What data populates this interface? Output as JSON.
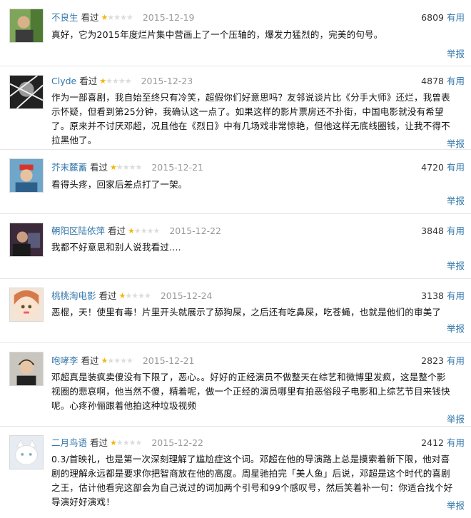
{
  "reviews": [
    {
      "user": "不良生",
      "seen": "看过",
      "rating": 1,
      "date": "2015-12-19",
      "votes": "6809",
      "useful_label": "有用",
      "text": "真好，它为2015年度烂片集中营画上了一个压轴的，爆发力猛烈的，完美的句号。",
      "report_label": "举报",
      "avatar_icon": "green-portrait-avatar"
    },
    {
      "user": "Clyde",
      "seen": "看过",
      "rating": 1,
      "date": "2015-12-23",
      "votes": "4878",
      "useful_label": "有用",
      "text": "作为一部喜剧，我自始至终只有冷笑，超假你们好意思吗？友邻说谈片比《分手大师》还烂，我曾表示怀疑，但看到第25分钟，我确认这一点了。如果这样的影片票房还不扑街，中国电影就没有希望了。原来并不讨厌邓超，况且他在《烈日》中有几场戏非常惊艳，但他这样无底线圈钱，让我不得不拉黑他了。",
      "report_label": "举报",
      "avatar_icon": "black-white-portrait-avatar"
    },
    {
      "user": "芥末麓蓄",
      "seen": "看过",
      "rating": 1,
      "date": "2015-12-21",
      "votes": "4720",
      "useful_label": "有用",
      "text": "看得头疼，回家后差点打了一架。",
      "report_label": "举报",
      "avatar_icon": "red-cap-man-avatar"
    },
    {
      "user": "朝阳区陆依萍",
      "seen": "看过",
      "rating": 1,
      "date": "2015-12-22",
      "votes": "3848",
      "useful_label": "有用",
      "text": "我都不好意思和别人说我看过....",
      "report_label": "举报",
      "avatar_icon": "dark-photo-avatar"
    },
    {
      "user": "桃桃淘电影",
      "seen": "看过",
      "rating": 1,
      "date": "2015-12-24",
      "votes": "3138",
      "useful_label": "有用",
      "text": "恶棍，天！使里有毒！片里开头就展示了舔狗屎，之后还有吃鼻屎，吃苍蝇，也就是他们的审美了",
      "report_label": "举报",
      "avatar_icon": "anime-girl-avatar"
    },
    {
      "user": "咆哮李",
      "seen": "看过",
      "rating": 1,
      "date": "2015-12-21",
      "votes": "2823",
      "useful_label": "有用",
      "text": "邓超真是装疯卖傻没有下限了，恶心。。好好的正经演员不做整天在综艺和微博里发疯，这是整个影视圈的悲哀啊，他当然不傻，精着呢，做一个正经的演员哪里有拍恶俗段子电影和上综艺节目来钱快呢。心疼孙俪跟着他拍这种垃圾视频",
      "report_label": "举报",
      "avatar_icon": "man-portrait-avatar"
    },
    {
      "user": "二月鸟语",
      "seen": "看过",
      "rating": 1,
      "date": "2015-12-22",
      "votes": "2412",
      "useful_label": "有用",
      "text": "0.3/首映礼，也是第一次深刻理解了尴尬症这个词。邓超在他的导演路上总是摸索着新下限，他对喜剧的理解永远都是要求你把智商放在他的高度。周星驰拍完「美人鱼」后说，邓超是这个时代的喜剧之王，估计他看完这部会为自己说过的词加两个引号和99个感叹号，然后笑着补一句：你适合找个好导演好好演戏！",
      "report_label": "举报",
      "avatar_icon": "white-cat-avatar"
    }
  ]
}
